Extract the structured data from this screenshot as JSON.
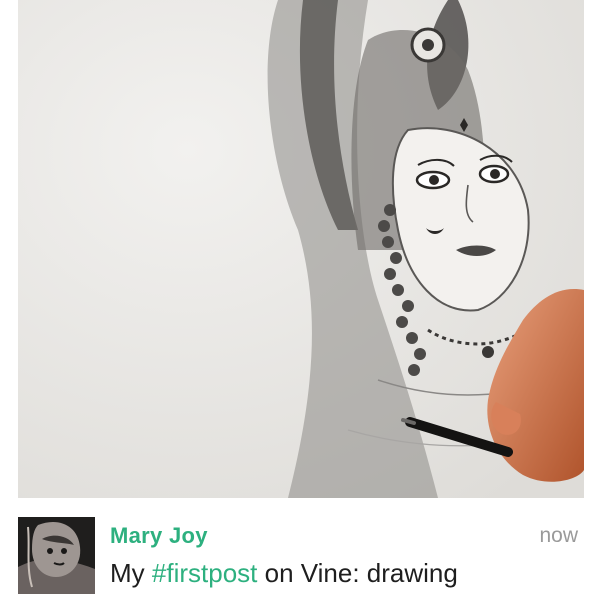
{
  "post": {
    "user_name": "Mary Joy",
    "timestamp": "now",
    "caption_prefix": "My ",
    "hashtag": "#firstpost",
    "caption_suffix": " on Vine: drawing",
    "accent_color": "#2db07f"
  },
  "icons": {
    "avatar": "avatar-thumbnail",
    "media": "sketch-drawing-video"
  }
}
